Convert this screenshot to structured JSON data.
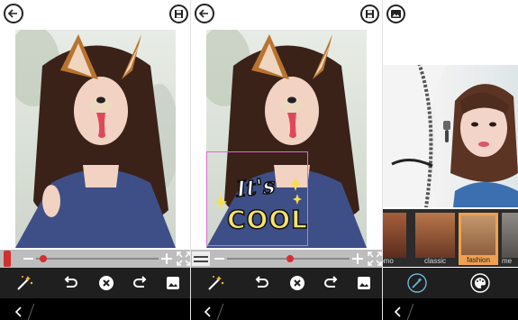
{
  "filters": {
    "items": [
      {
        "label": "omo"
      },
      {
        "label": "classic"
      },
      {
        "label": "fashion",
        "selected": true
      },
      {
        "label": "me"
      }
    ]
  },
  "sticker": {
    "text_line1": "It's",
    "text_line2": "COOL"
  },
  "colors": {
    "toolbar_bg": "#1f1f1f",
    "navbar_bg": "#000000",
    "slider_track": "#bdbdbd",
    "slider_accent": "#d32f2f",
    "filter_selected": "#f0a050"
  },
  "icons": [
    "back-arrow-icon",
    "save-icon",
    "gallery-icon",
    "magic-wand-icon",
    "undo-icon",
    "clear-icon",
    "redo-icon",
    "image-icon",
    "palette-icon",
    "expand-icon",
    "zipper-icon"
  ]
}
